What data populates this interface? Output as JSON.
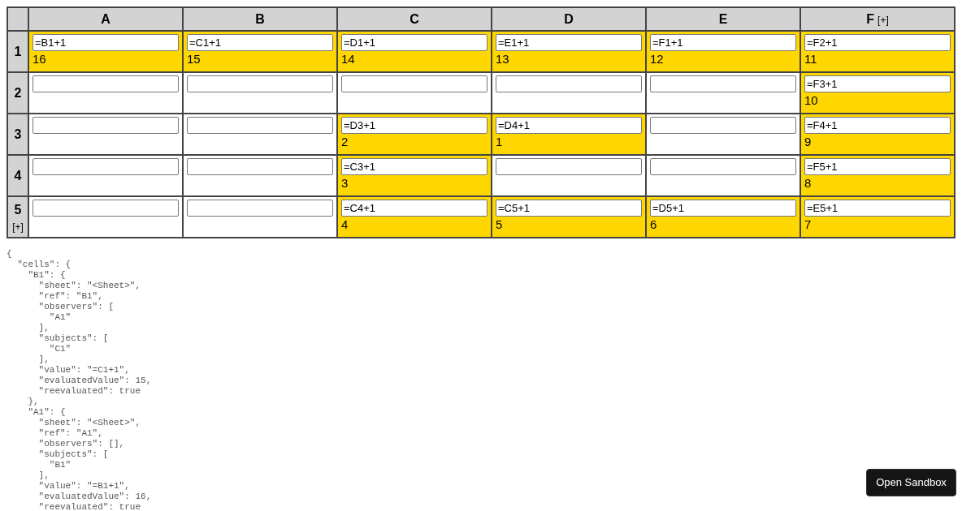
{
  "table": {
    "columns": [
      {
        "label": "A"
      },
      {
        "label": "B"
      },
      {
        "label": "C"
      },
      {
        "label": "D"
      },
      {
        "label": "E"
      },
      {
        "label": "F",
        "add": "[+]"
      }
    ],
    "rows": [
      {
        "label": "1",
        "cells": [
          {
            "formula": "=B1+1",
            "value": "16",
            "highlighted": true
          },
          {
            "formula": "=C1+1",
            "value": "15",
            "highlighted": true
          },
          {
            "formula": "=D1+1",
            "value": "14",
            "highlighted": true
          },
          {
            "formula": "=E1+1",
            "value": "13",
            "highlighted": true
          },
          {
            "formula": "=F1+1",
            "value": "12",
            "highlighted": true
          },
          {
            "formula": "=F2+1",
            "value": "11",
            "highlighted": true
          }
        ]
      },
      {
        "label": "2",
        "cells": [
          {
            "highlighted": false
          },
          {
            "highlighted": false
          },
          {
            "highlighted": false
          },
          {
            "highlighted": false
          },
          {
            "highlighted": false
          },
          {
            "formula": "=F3+1",
            "value": "10",
            "highlighted": true
          }
        ]
      },
      {
        "label": "3",
        "cells": [
          {
            "highlighted": false
          },
          {
            "highlighted": false
          },
          {
            "formula": "=D3+1",
            "value": "2",
            "highlighted": true
          },
          {
            "formula": "=D4+1",
            "value": "1",
            "highlighted": true
          },
          {
            "highlighted": false
          },
          {
            "formula": "=F4+1",
            "value": "9",
            "highlighted": true
          }
        ]
      },
      {
        "label": "4",
        "cells": [
          {
            "highlighted": false
          },
          {
            "highlighted": false
          },
          {
            "formula": "=C3+1",
            "value": "3",
            "highlighted": true
          },
          {
            "highlighted": false
          },
          {
            "highlighted": false
          },
          {
            "formula": "=F5+1",
            "value": "8",
            "highlighted": true
          }
        ]
      },
      {
        "label": "5",
        "add": "[+]",
        "cells": [
          {
            "highlighted": false
          },
          {
            "highlighted": false
          },
          {
            "formula": "=C4+1",
            "value": "4",
            "highlighted": true
          },
          {
            "formula": "=C5+1",
            "value": "5",
            "highlighted": true
          },
          {
            "formula": "=D5+1",
            "value": "6",
            "highlighted": true
          },
          {
            "formula": "=E5+1",
            "value": "7",
            "highlighted": true
          }
        ]
      }
    ]
  },
  "debug_output": "{\n  \"cells\": {\n    \"B1\": {\n      \"sheet\": \"<Sheet>\",\n      \"ref\": \"B1\",\n      \"observers\": [\n        \"A1\"\n      ],\n      \"subjects\": [\n        \"C1\"\n      ],\n      \"value\": \"=C1+1\",\n      \"evaluatedValue\": 15,\n      \"reevaluated\": true\n    },\n    \"A1\": {\n      \"sheet\": \"<Sheet>\",\n      \"ref\": \"A1\",\n      \"observers\": [],\n      \"subjects\": [\n        \"B1\"\n      ],\n      \"value\": \"=B1+1\",\n      \"evaluatedValue\": 16,\n      \"reevaluated\": true",
  "sandbox_button": "Open Sandbox"
}
